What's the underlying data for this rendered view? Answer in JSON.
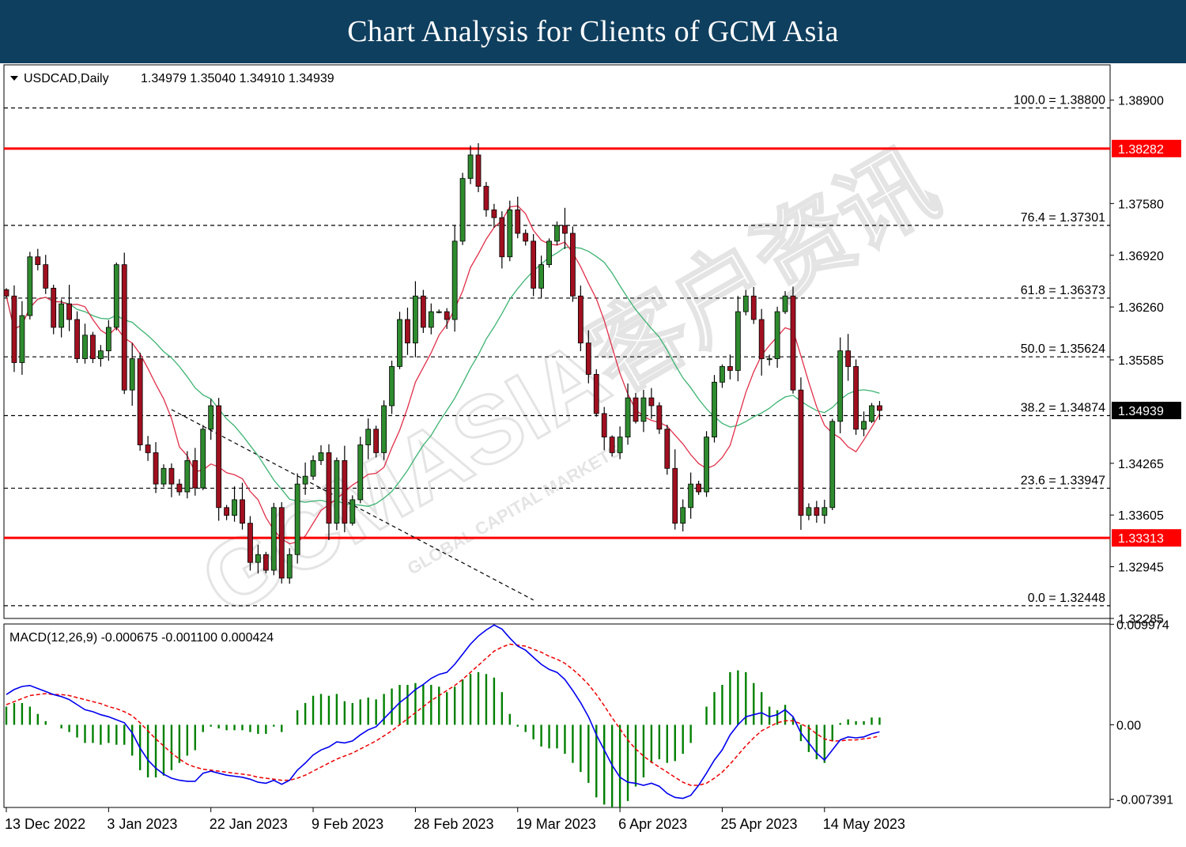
{
  "header": {
    "title": "Chart Analysis for Clients of GCM Asia"
  },
  "watermark": {
    "main": "GCMASIA客户资讯",
    "sub": "GLOBAL CAPITAL MARKETS"
  },
  "chart_data": {
    "type": "candlestick",
    "symbol_label": "USDCAD,Daily",
    "ohlc_readout": "1.34979 1.35040 1.34910 1.34939",
    "price_axis": {
      "ylim": [
        1.32285,
        1.3935
      ],
      "ticks": [
        "1.38900",
        "1.37580",
        "1.36920",
        "1.36260",
        "1.35585",
        "1.34265",
        "1.33605",
        "1.32945",
        "1.32285"
      ]
    },
    "x_axis": {
      "labels": [
        {
          "label": "13 Dec 2022",
          "index": 0
        },
        {
          "label": "3 Jan 2023",
          "index": 13
        },
        {
          "label": "22 Jan 2023",
          "index": 26
        },
        {
          "label": "9 Feb 2023",
          "index": 39
        },
        {
          "label": "28 Feb 2023",
          "index": 52
        },
        {
          "label": "19 Mar 2023",
          "index": 65
        },
        {
          "label": "6 Apr 2023",
          "index": 78
        },
        {
          "label": "25 Apr 2023",
          "index": 91
        },
        {
          "label": "14 May 2023",
          "index": 104
        }
      ]
    },
    "fib_levels": [
      {
        "label": "100.0 = 1.38800",
        "value": 1.388
      },
      {
        "label": "76.4 = 1.37301",
        "value": 1.37301
      },
      {
        "label": "61.8 = 1.36373",
        "value": 1.36373
      },
      {
        "label": "50.0 = 1.35624",
        "value": 1.35624
      },
      {
        "label": "38.2 = 1.34874",
        "value": 1.34874
      },
      {
        "label": "23.6 = 1.33947",
        "value": 1.33947
      },
      {
        "label": "0.0 = 1.32448",
        "value": 1.32448
      }
    ],
    "horizontal_lines": [
      {
        "label": "1.38282",
        "value": 1.38282,
        "color": "#ff0000"
      },
      {
        "label": "1.33313",
        "value": 1.33313,
        "color": "#ff0000"
      }
    ],
    "current_price": {
      "label": "1.34939",
      "value": 1.34939
    },
    "trendline": {
      "start": {
        "index": 21,
        "value": 1.3495
      },
      "end": {
        "index": 67,
        "value": 1.3252
      }
    },
    "colors": {
      "up": "#2e8b2e",
      "down": "#a01020",
      "ma_fast": "#e0304a",
      "ma_slow": "#3cb371",
      "macd": "#0000ee",
      "signal": "#ee0000",
      "histogram": "#008000",
      "level_line": "#ff0000"
    },
    "closes": [
      1.364,
      1.3555,
      1.3615,
      1.369,
      1.368,
      1.365,
      1.36,
      1.363,
      1.361,
      1.356,
      1.359,
      1.356,
      1.357,
      1.36,
      1.368,
      1.352,
      1.356,
      1.345,
      1.344,
      1.34,
      1.342,
      1.34,
      1.339,
      1.343,
      1.3395,
      1.347,
      1.35,
      1.337,
      1.336,
      1.338,
      1.335,
      1.33,
      1.331,
      1.329,
      1.337,
      1.328,
      1.331,
      1.34,
      1.341,
      1.343,
      1.344,
      1.335,
      1.343,
      1.335,
      1.338,
      1.345,
      1.347,
      1.344,
      1.35,
      1.355,
      1.361,
      1.358,
      1.364,
      1.36,
      1.362,
      1.362,
      1.361,
      1.371,
      1.379,
      1.382,
      1.378,
      1.375,
      1.374,
      1.369,
      1.375,
      1.372,
      1.371,
      1.365,
      1.368,
      1.371,
      1.373,
      1.372,
      1.364,
      1.358,
      1.354,
      1.349,
      1.346,
      1.344,
      1.346,
      1.351,
      1.348,
      1.351,
      1.35,
      1.347,
      1.342,
      1.335,
      1.337,
      1.34,
      1.339,
      1.346,
      1.353,
      1.355,
      1.3545,
      1.362,
      1.364,
      1.361,
      1.356,
      1.356,
      1.362,
      1.364,
      1.352,
      1.336,
      1.337,
      1.336,
      1.337,
      1.348,
      1.357,
      1.355,
      1.347,
      1.348,
      1.35,
      1.3494
    ],
    "macd": {
      "label": "MACD(12,26,9) -0.000675 -0.001100 0.000424",
      "ylim": [
        -0.0082,
        0.01
      ],
      "ticks": [
        "0.009974",
        "0.00",
        "-0.007391"
      ],
      "macd_series": [
        0.003,
        0.0035,
        0.0038,
        0.0039,
        0.0036,
        0.0033,
        0.003,
        0.0028,
        0.0025,
        0.002,
        0.0015,
        0.0013,
        0.001,
        0.0008,
        0.0005,
        0.0002,
        -0.0008,
        -0.0023,
        -0.0035,
        -0.0043,
        -0.0049,
        -0.0053,
        -0.0055,
        -0.0056,
        -0.0056,
        -0.0048,
        -0.0046,
        -0.0048,
        -0.005,
        -0.0051,
        -0.0052,
        -0.0054,
        -0.0057,
        -0.0058,
        -0.0055,
        -0.0059,
        -0.0055,
        -0.0045,
        -0.0038,
        -0.003,
        -0.0025,
        -0.0022,
        -0.0017,
        -0.0018,
        -0.0016,
        -0.001,
        -0.0005,
        -0.0002,
        0.0006,
        0.0014,
        0.0022,
        0.0028,
        0.0035,
        0.004,
        0.0046,
        0.005,
        0.0052,
        0.006,
        0.007,
        0.008,
        0.0088,
        0.0094,
        0.0099,
        0.0095,
        0.0086,
        0.0078,
        0.0074,
        0.0067,
        0.006,
        0.0055,
        0.0052,
        0.0045,
        0.0034,
        0.0022,
        0.0008,
        -0.001,
        -0.0025,
        -0.004,
        -0.0052,
        -0.0057,
        -0.0058,
        -0.006,
        -0.0058,
        -0.0061,
        -0.0068,
        -0.0072,
        -0.0073,
        -0.007,
        -0.006,
        -0.0048,
        -0.0035,
        -0.0025,
        -0.001,
        0.0,
        0.0008,
        0.001,
        0.0012,
        0.0008,
        0.001,
        0.0015,
        0.0008,
        -0.0008,
        -0.0018,
        -0.0028,
        -0.0035,
        -0.0025,
        -0.0015,
        -0.0012,
        -0.0013,
        -0.0012,
        -0.0009,
        -0.0007
      ],
      "signal_series": [
        0.002,
        0.0023,
        0.0026,
        0.0029,
        0.003,
        0.0031,
        0.003,
        0.003,
        0.0029,
        0.0027,
        0.0025,
        0.0023,
        0.0021,
        0.0018,
        0.0016,
        0.0013,
        0.0009,
        0.0002,
        -0.0006,
        -0.0014,
        -0.0021,
        -0.0028,
        -0.0034,
        -0.0039,
        -0.0042,
        -0.0044,
        -0.0045,
        -0.0046,
        -0.0047,
        -0.0048,
        -0.0049,
        -0.005,
        -0.0052,
        -0.0053,
        -0.0054,
        -0.0055,
        -0.0055,
        -0.0053,
        -0.005,
        -0.0046,
        -0.0042,
        -0.0038,
        -0.0034,
        -0.0031,
        -0.0028,
        -0.0024,
        -0.002,
        -0.0016,
        -0.0011,
        -0.0006,
        0.0,
        0.0006,
        0.0012,
        0.0018,
        0.0024,
        0.0029,
        0.0034,
        0.0039,
        0.0045,
        0.0052,
        0.0059,
        0.0066,
        0.0073,
        0.0077,
        0.008,
        0.0079,
        0.0078,
        0.0075,
        0.0072,
        0.0068,
        0.0065,
        0.0061,
        0.0055,
        0.0048,
        0.004,
        0.003,
        0.0019,
        0.0007,
        -0.0004,
        -0.0015,
        -0.0024,
        -0.0031,
        -0.0037,
        -0.0042,
        -0.0047,
        -0.0052,
        -0.0057,
        -0.006,
        -0.006,
        -0.0058,
        -0.0053,
        -0.0047,
        -0.0039,
        -0.003,
        -0.0021,
        -0.0013,
        -0.0006,
        -0.0002,
        0.0002,
        0.0004,
        0.0004,
        0.0001,
        -0.0003,
        -0.0009,
        -0.0014,
        -0.0016,
        -0.0016,
        -0.0015,
        -0.0015,
        -0.0014,
        -0.0013,
        -0.0011
      ]
    }
  }
}
